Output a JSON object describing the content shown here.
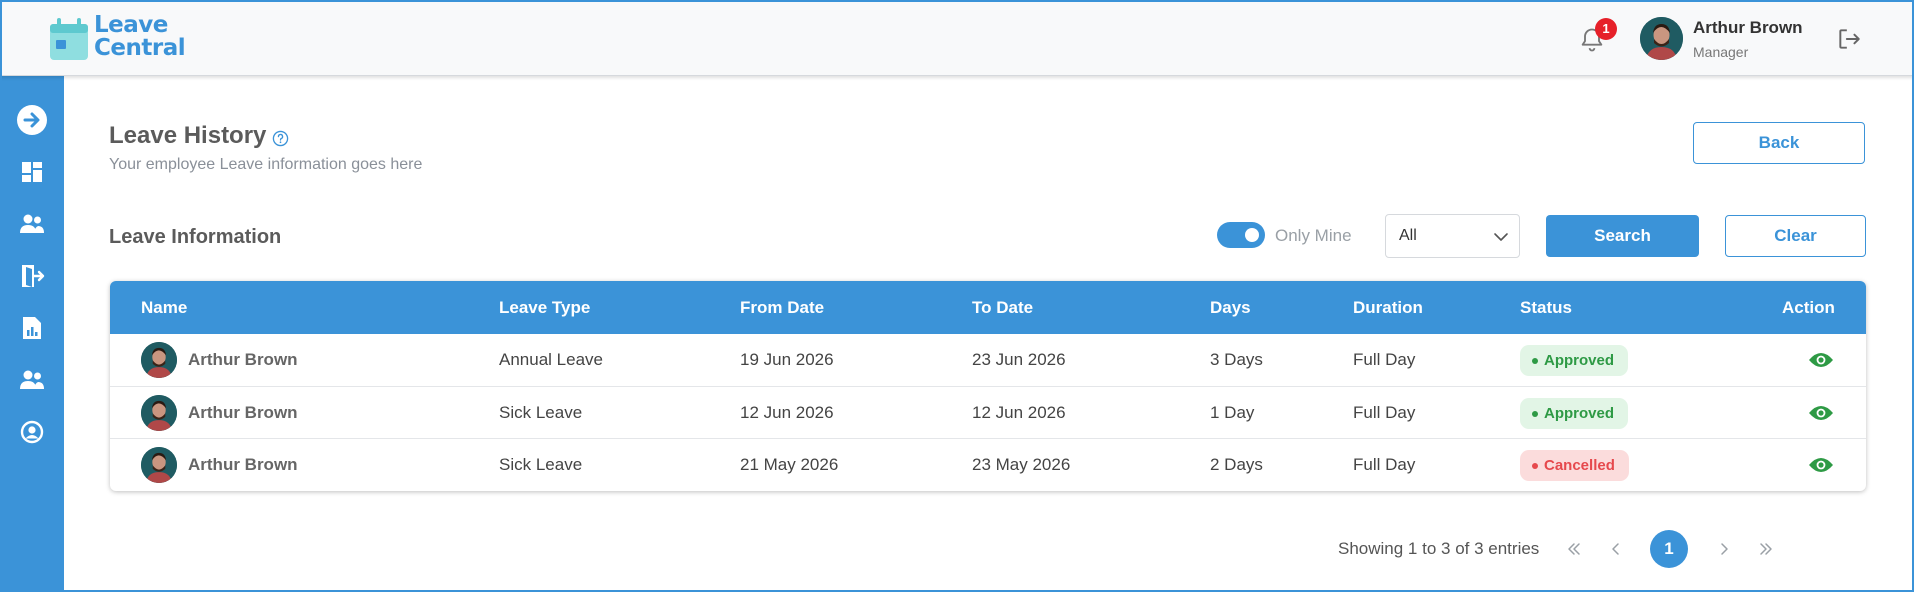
{
  "brand": {
    "logo_line1": "Leave",
    "logo_line2": "Central",
    "color": "#3b93d8"
  },
  "header": {
    "notification_count": "1",
    "user_name": "Arthur Brown",
    "user_role": "Manager"
  },
  "sidebar": {
    "items": [
      {
        "icon": "arrow-right-circle-icon"
      },
      {
        "icon": "dashboard-icon"
      },
      {
        "icon": "team-icon"
      },
      {
        "icon": "leave-exit-icon"
      },
      {
        "icon": "report-icon"
      },
      {
        "icon": "people-icon"
      },
      {
        "icon": "user-circle-icon"
      }
    ]
  },
  "page": {
    "title": "Leave History",
    "subtitle": "Your employee Leave information goes here",
    "back_label": "Back"
  },
  "filters": {
    "section_title": "Leave Information",
    "only_mine_label": "Only Mine",
    "only_mine_on": true,
    "select_value": "All",
    "search_label": "Search",
    "clear_label": "Clear"
  },
  "table": {
    "headers": [
      "Name",
      "Leave Type",
      "From Date",
      "To Date",
      "Days",
      "Duration",
      "Status",
      "Action"
    ],
    "rows": [
      {
        "name": "Arthur Brown",
        "leave_type": "Annual Leave",
        "from": "19 Jun 2026",
        "to": "23 Jun 2026",
        "days": "3 Days",
        "duration": "Full Day",
        "status": "Approved"
      },
      {
        "name": "Arthur Brown",
        "leave_type": "Sick Leave",
        "from": "12 Jun 2026",
        "to": "12 Jun 2026",
        "days": "1 Day",
        "duration": "Full Day",
        "status": "Approved"
      },
      {
        "name": "Arthur Brown",
        "leave_type": "Sick Leave",
        "from": "21 May 2026",
        "to": "23 May 2026",
        "days": "2 Days",
        "duration": "Full Day",
        "status": "Cancelled"
      }
    ]
  },
  "pagination": {
    "info": "Showing 1 to 3 of 3 entries",
    "current_page": "1"
  }
}
